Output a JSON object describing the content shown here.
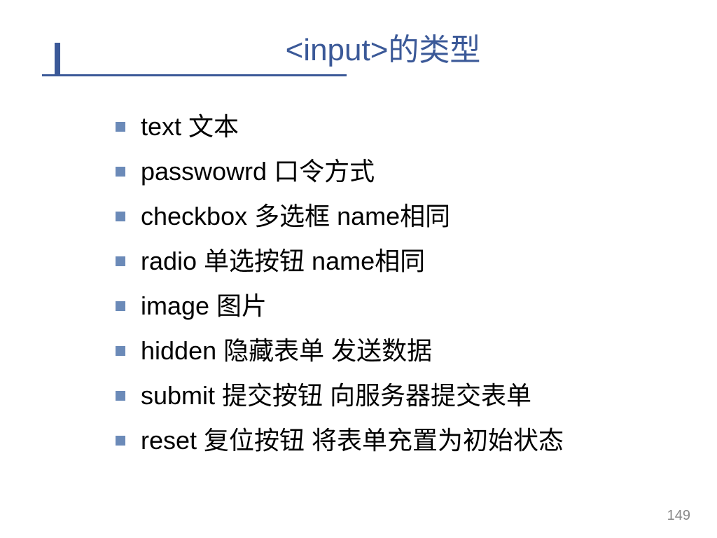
{
  "title": "<input>的类型",
  "items": [
    "text  文本",
    "passwowrd  口令方式",
    "checkbox  多选框    name相同",
    "radio  单选按钮     name相同",
    "image  图片",
    "hidden  隐藏表单  发送数据",
    "submit  提交按钮  向服务器提交表单",
    "reset  复位按钮  将表单充置为初始状态"
  ],
  "page_number": "149"
}
